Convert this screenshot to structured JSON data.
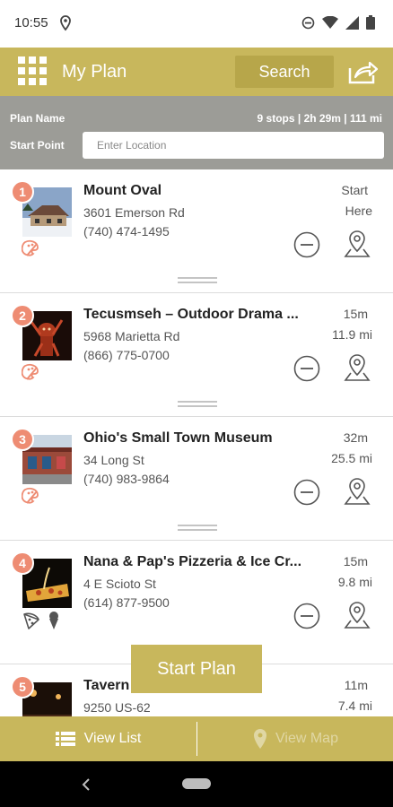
{
  "status": {
    "time": "10:55"
  },
  "header": {
    "title": "My Plan",
    "search_label": "Search"
  },
  "plan": {
    "plan_name_label": "Plan Name",
    "summary": "9 stops | 2h 29m | 111 mi",
    "start_point_label": "Start Point",
    "location_placeholder": "Enter Location"
  },
  "stops": [
    {
      "number": "1",
      "name": "Mount Oval",
      "address": "3601 Emerson Rd",
      "phone": "(740) 474-1495",
      "time": "Start",
      "distance": "Here"
    },
    {
      "number": "2",
      "name": "Tecusmseh – Outdoor Drama ...",
      "address": "5968 Marietta Rd",
      "phone": "(866) 775-0700",
      "time": "15m",
      "distance": "11.9 mi"
    },
    {
      "number": "3",
      "name": "Ohio's Small Town Museum",
      "address": "34 Long St",
      "phone": "(740) 983-9864",
      "time": "32m",
      "distance": "25.5 mi"
    },
    {
      "number": "4",
      "name": "Nana & Pap's Pizzeria & Ice Cr...",
      "address": "4 E Scioto St",
      "phone": "(614) 877-9500",
      "time": "15m",
      "distance": "9.8 mi"
    },
    {
      "number": "5",
      "name": "Tavern 62",
      "address": "9250 US-62",
      "phone": "",
      "time": "11m",
      "distance": "7.4 mi"
    }
  ],
  "start_plan_label": "Start Plan",
  "tabs": {
    "list_label": "View List",
    "map_label": "View Map"
  },
  "colors": {
    "accent": "#c8b75c",
    "accent_dark": "#b7a64a",
    "badge": "#ee8c73",
    "info_bar": "#9c9c97"
  }
}
